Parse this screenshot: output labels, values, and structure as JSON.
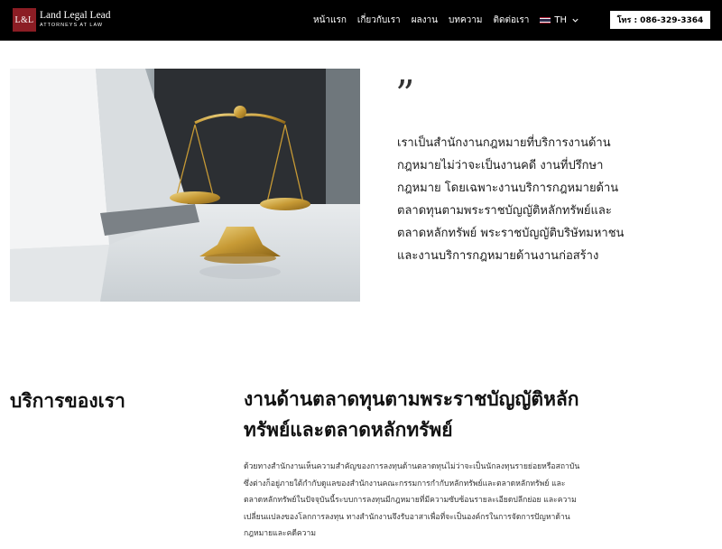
{
  "logo": {
    "mark": "L&L",
    "name": "Land Legal Lead",
    "subtitle": "ATTORNEYS AT LAW"
  },
  "nav": {
    "items": [
      "หน้าแรก",
      "เกี่ยวกับเรา",
      "ผลงาน",
      "บทความ",
      "ติดต่อเรา"
    ],
    "language": "TH",
    "flag_colors": [
      "#a51931",
      "#f4f5f8",
      "#2d2a4a",
      "#f4f5f8",
      "#a51931"
    ]
  },
  "phone_button": "โทร : 086-329-3364",
  "quote": {
    "mark": "”",
    "lines": [
      "เราเป็นสำนักงานกฎหมายที่บริการงานด้าน",
      "กฎหมายไม่ว่าจะเป็นงานคดี งานที่ปรึกษา",
      "กฎหมาย โดยเฉพาะงานบริการกฎหมายด้าน",
      "ตลาดทุนตามพระราชบัญญัติหลักทรัพย์และ",
      "ตลาดหลักทรัพย์ พระราชบัญญัติบริษัทมหาชน",
      "และงานบริการกฎหมายด้านงานก่อสร้าง"
    ]
  },
  "services": {
    "heading": "บริการของเรา",
    "title_lines": [
      "งานด้านตลาดทุนตามพระราชบัญญัติหลัก",
      "ทรัพย์และตลาดหลักทรัพย์"
    ],
    "description_lines": [
      "ด้วยทางสำนักงานเห็นความสำคัญของการลงทุนด้านตลาดทุนไม่ว่าจะเป็นนักลงทุนรายย่อยหรือสถาบัน",
      "ซึ่งต่างก็อยู่ภายใต้กำกับดูแลของสำนักงานคณะกรรมการกำกับหลักทรัพย์และตลาดหลักทรัพย์ และ",
      "ตลาดหลักทรัพย์ในปัจจุบันนี้ระบบการลงทุนมีกฎหมายที่มีความซับซ้อนรายละเอียดปลีกย่อย และความ",
      "เปลี่ยนแปลงของโลกการลงทุน ทางสำนักงานจึงรับอาสาเพื่อที่จะเป็นองค์กรในการจัดการปัญหาด้าน",
      "กฎหมายและคดีความ"
    ]
  }
}
